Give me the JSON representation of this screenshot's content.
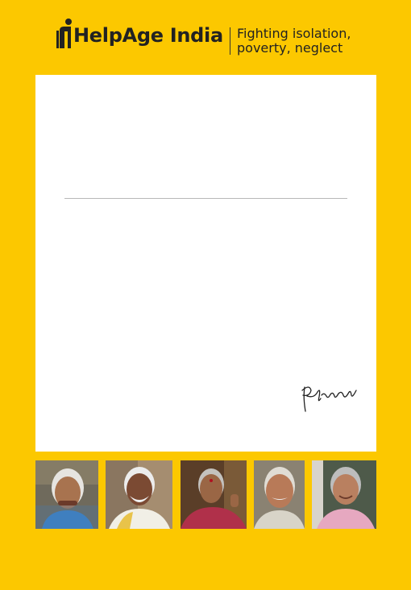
{
  "header": {
    "brand_name": "HelpAge India",
    "tagline_line1": "Fighting isolation,",
    "tagline_line2": "poverty, neglect",
    "logo_icon": "person-with-cane-icon"
  },
  "colors": {
    "background": "#fcc800",
    "panel": "#ffffff",
    "text": "#222222",
    "rule": "#b8b8b8"
  },
  "letter": {
    "signature_icon": "handwritten-signature",
    "signature_text": "RPrasad"
  },
  "photos": [
    {
      "name": "elderly-woman-1"
    },
    {
      "name": "elderly-man-1"
    },
    {
      "name": "elderly-woman-2"
    },
    {
      "name": "elderly-man-2"
    },
    {
      "name": "elderly-woman-3"
    }
  ]
}
